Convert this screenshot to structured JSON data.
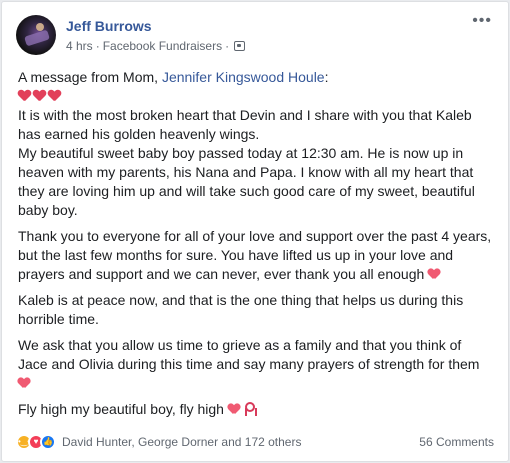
{
  "post": {
    "author": "Jeff Burrows",
    "time": "4 hrs",
    "separator": "·",
    "source": "Facebook Fundraisers",
    "more": "•••",
    "icons": {
      "audience": "globe-icon",
      "more": "more-icon",
      "heart": "heart-icon",
      "broken_heart": "broken-heart-icon",
      "ribbon": "ribbon-icon"
    }
  },
  "body": {
    "intro_text": "A message from Mom, ",
    "intro_link": "Jennifer Kingswood Houle",
    "intro_end": ":",
    "p1": "It is with the most broken heart that Devin and I share with you that Kaleb has earned his golden heavenly wings.",
    "p2": "My beautiful sweet baby boy passed today at 12:30 am. He is now up in heaven with my parents, his Nana and Papa. I know with all my heart that they are loving him up and will take such good care of my sweet, beautiful baby boy.",
    "p3": "Thank you to everyone for all of your love and support over the past 4 years, but the last few months for sure. You have lifted us up in your love and prayers and support and we can never, ever thank you all enough",
    "p4": "Kaleb is at peace now, and that is the one thing that helps us during this horrible time.",
    "p5": "We ask that you allow us time to grieve as a family and that you think of Jace and Olivia during this time and say many prayers of strength for them",
    "p6": "Fly high my beautiful boy, fly high"
  },
  "footer": {
    "reactions": [
      "sad-icon",
      "love-icon",
      "like-icon"
    ],
    "reactors": "David Hunter, George Dorner and 172 others",
    "comments": "56 Comments"
  }
}
